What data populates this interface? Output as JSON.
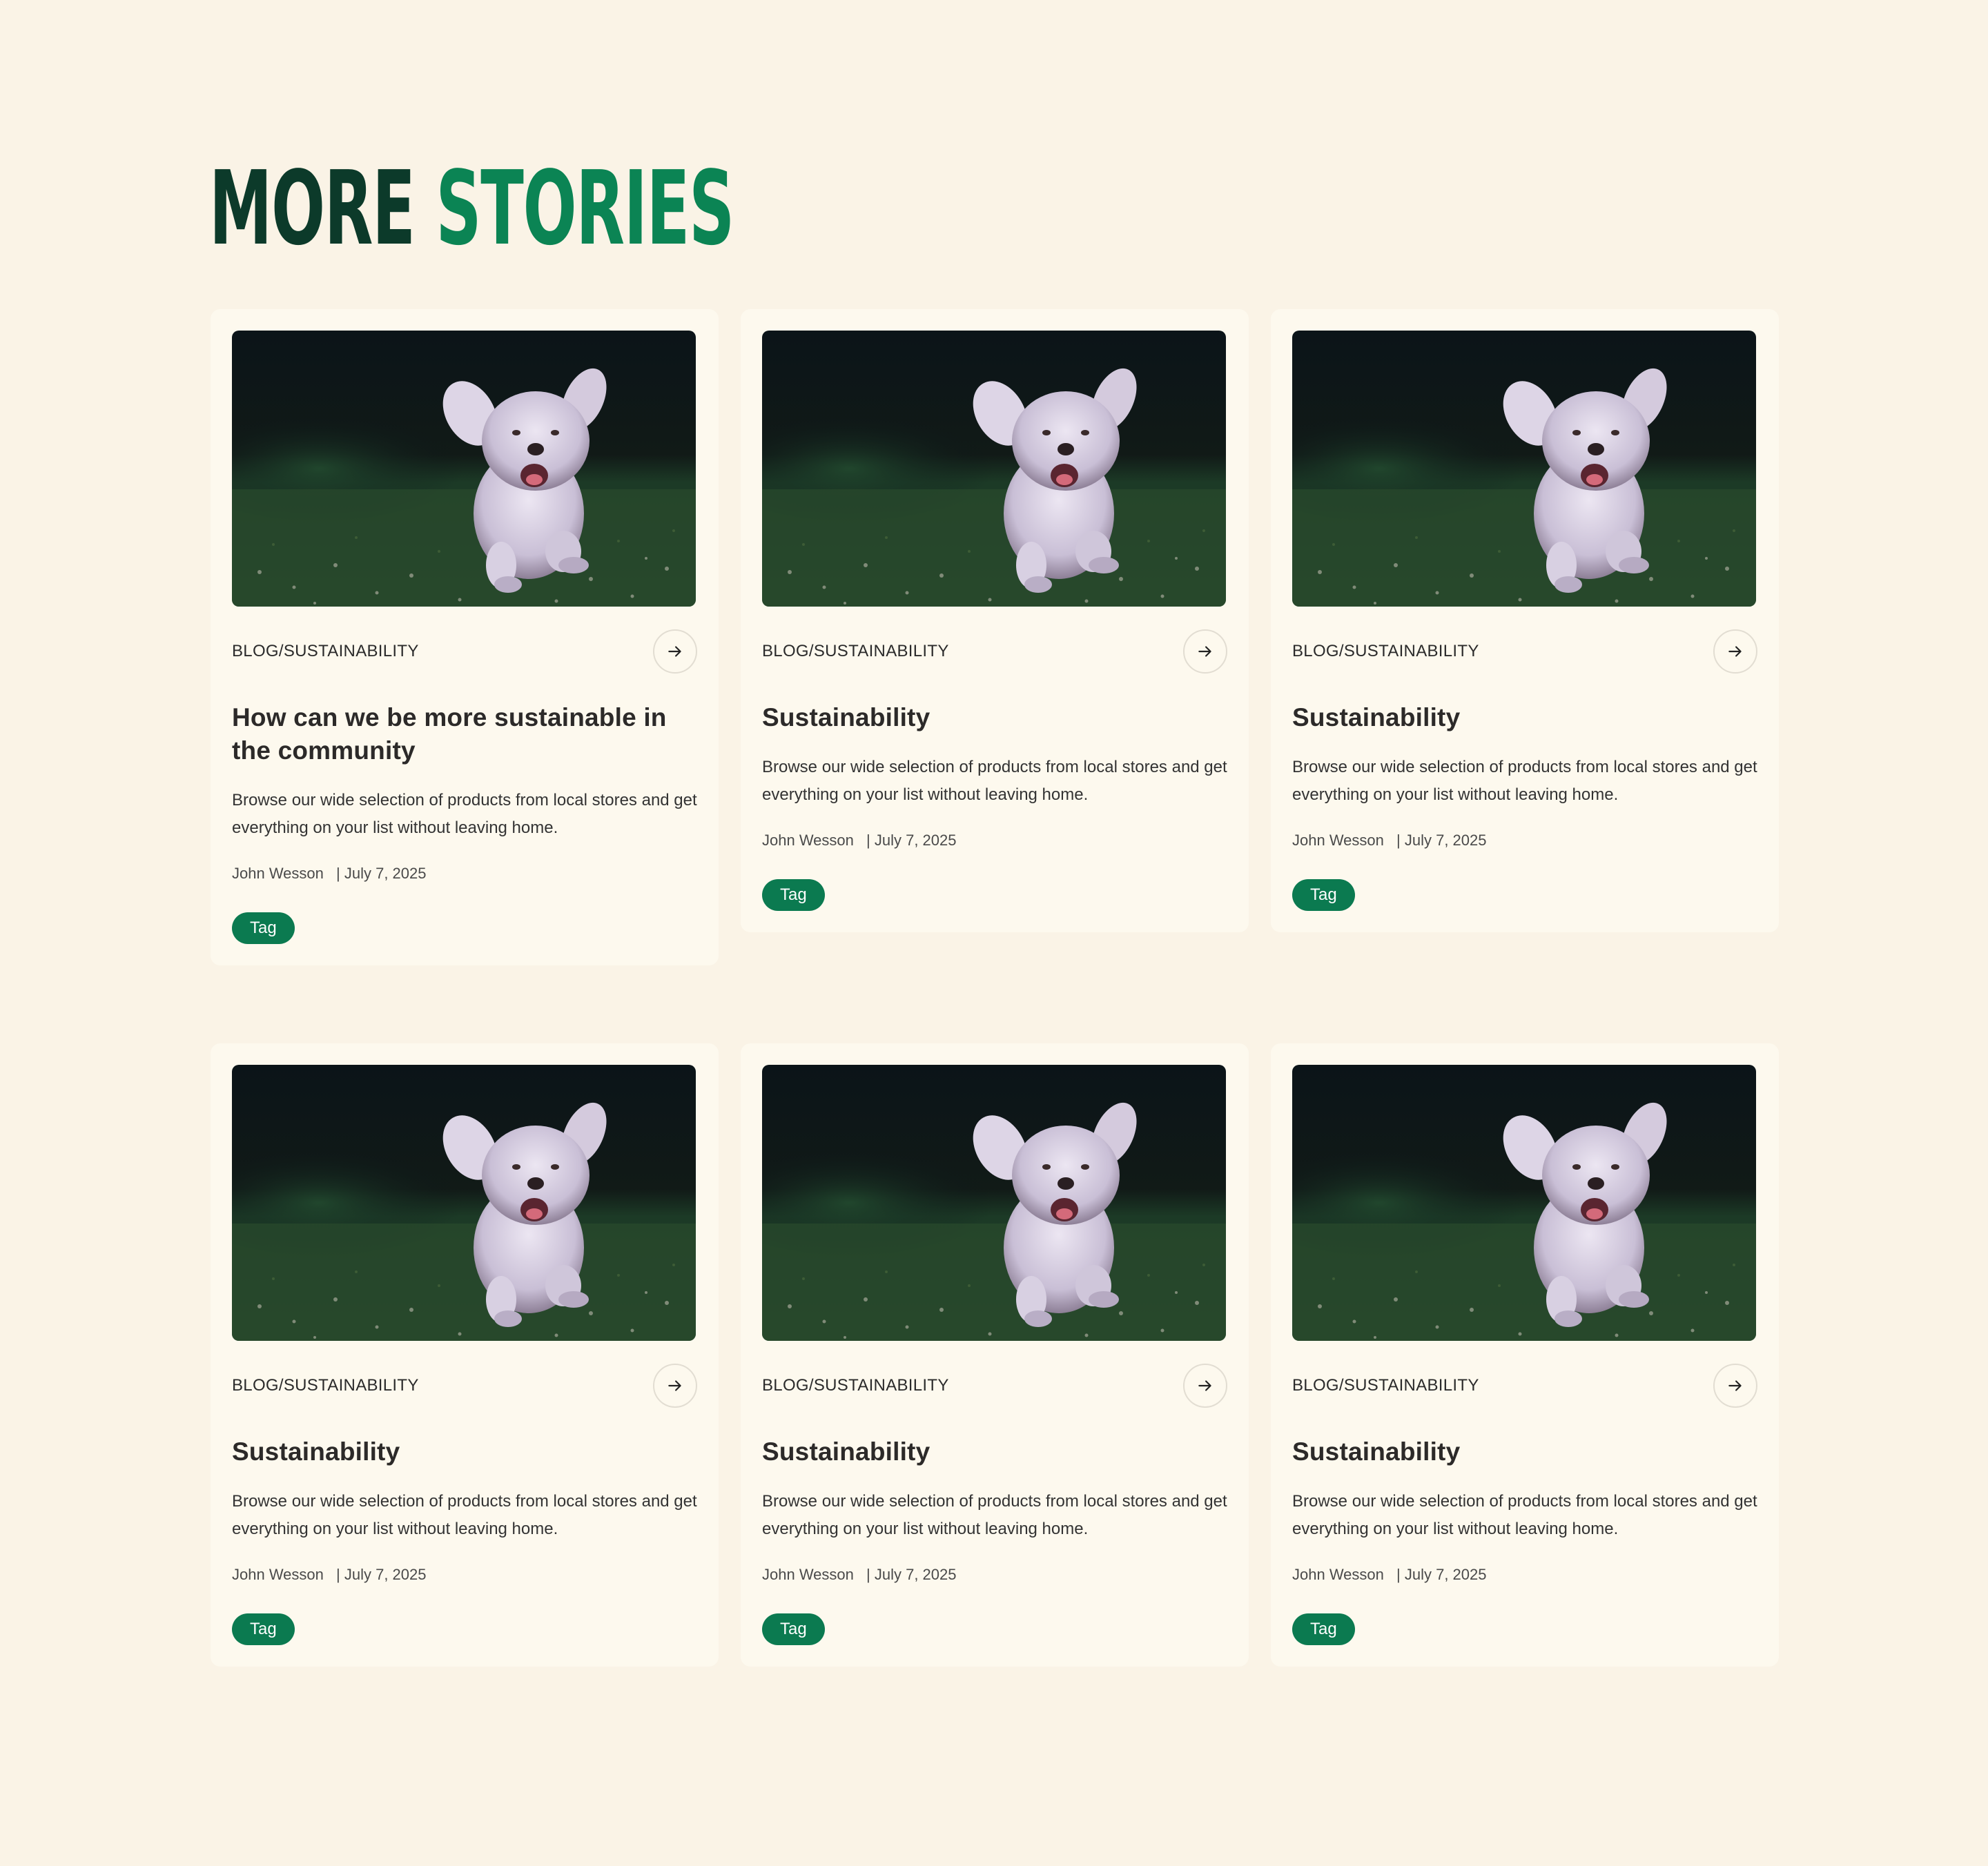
{
  "section": {
    "title_part1": "MORE",
    "title_part2": "STORIES"
  },
  "colors": {
    "background": "#faf3e6",
    "card": "#fdf9ee",
    "title_dark": "#0c3a2a",
    "title_green": "#0b8454",
    "tag_bg": "#0b7a50"
  },
  "cards": [
    {
      "category": "BLOG/SUSTAINABILITY",
      "title": "How can we be more sustainable in the community",
      "description": "Browse our wide selection of products from local stores and get everything on your list without leaving home.",
      "author": "John Wesson",
      "date": "| July 7, 2025",
      "tag": "Tag",
      "image": "running-dog-photo",
      "arrow_icon": "arrow-right-icon"
    },
    {
      "category": "BLOG/SUSTAINABILITY",
      "title": "Sustainability",
      "description": "Browse our wide selection of products from local stores and get everything on your list without leaving home.",
      "author": "John Wesson",
      "date": "| July 7, 2025",
      "tag": "Tag",
      "image": "running-dog-photo",
      "arrow_icon": "arrow-right-icon"
    },
    {
      "category": "BLOG/SUSTAINABILITY",
      "title": "Sustainability",
      "description": "Browse our wide selection of products from local stores and get everything on your list without leaving home.",
      "author": "John Wesson",
      "date": "| July 7, 2025",
      "tag": "Tag",
      "image": "running-dog-photo",
      "arrow_icon": "arrow-right-icon"
    },
    {
      "category": "BLOG/SUSTAINABILITY",
      "title": "Sustainability",
      "description": "Browse our wide selection of products from local stores and get everything on your list without leaving home.",
      "author": "John Wesson",
      "date": "| July 7, 2025",
      "tag": "Tag",
      "image": "running-dog-photo",
      "arrow_icon": "arrow-right-icon"
    },
    {
      "category": "BLOG/SUSTAINABILITY",
      "title": "Sustainability",
      "description": "Browse our wide selection of products from local stores and get everything on your list without leaving home.",
      "author": "John Wesson",
      "date": "| July 7, 2025",
      "tag": "Tag",
      "image": "running-dog-photo",
      "arrow_icon": "arrow-right-icon"
    },
    {
      "category": "BLOG/SUSTAINABILITY",
      "title": "Sustainability",
      "description": "Browse our wide selection of products from local stores and get everything on your list without leaving home.",
      "author": "John Wesson",
      "date": "| July 7, 2025",
      "tag": "Tag",
      "image": "running-dog-photo",
      "arrow_icon": "arrow-right-icon"
    }
  ]
}
